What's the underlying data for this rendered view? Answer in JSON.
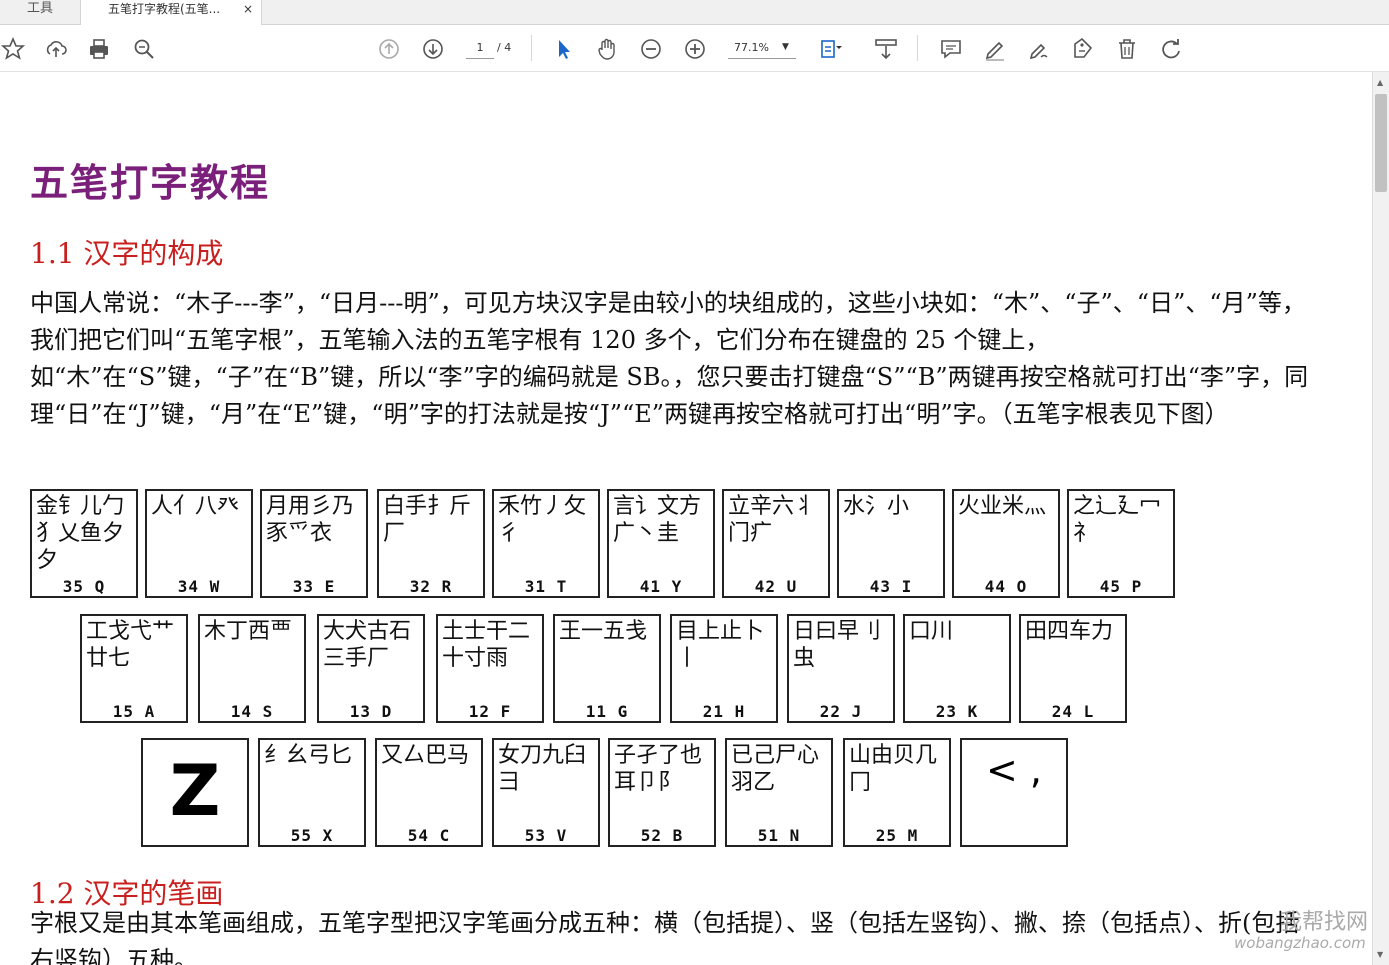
{
  "tabs": [
    {
      "label": "工具"
    },
    {
      "label": "五笔打字教程(五笔...",
      "close": "×"
    }
  ],
  "toolbar": {
    "page_current": "1",
    "page_total": "/ 4",
    "zoom": "77.1%",
    "zoom_caret": "▼",
    "icons": [
      "bookmark-star-icon",
      "upload-cloud-icon",
      "print-icon",
      "zoom-search-icon",
      "page-up-icon",
      "page-down-icon",
      "select-arrow-icon",
      "hand-pan-icon",
      "zoom-out-icon",
      "zoom-in-icon",
      "fit-page-icon",
      "scroll-mode-icon",
      "comment-icon",
      "highlight-pen-icon",
      "sign-icon",
      "stamp-icon",
      "delete-icon",
      "undo-icon"
    ]
  },
  "document": {
    "title": "五笔打字教程",
    "section1": "1.1 汉字的构成",
    "para1": "中国人常说：“木子---李”，“日月---明”，可见方块汉字是由较小的块组成的，这些小块如：“木”、“子”、“日”、“月”等，我们把它们叫“五笔字根”，五笔输入法的五笔字根有 120 多个，它们分布在键盘的 25 个键上，如“木”在“S”键，“子”在“B”键，所以“李”字的编码就是 SB。，您只要击打键盘“S”“B”两键再按空格就可打出“李”字，同理“日”在“J”键，“月”在“E”键，“明”字的打法就是按“J”“E”两键再按空格就可打出“明”字。（五笔字根表见下图）",
    "section2": "1.2 汉字的笔画",
    "para2": "字根又是由其本笔画组成，五笔字型把汉字笔画分成五种：横（包括提）、竖（包括左竖钩）、撇、捺（包括点）、折(包括右竖钩）五种。"
  },
  "keyboard": {
    "row1": [
      {
        "roots": "金钅儿勹犭乂鱼夕夕",
        "code": "35 Q"
      },
      {
        "roots": "人亻八癶",
        "code": "34 W"
      },
      {
        "roots": "月用彡乃豕爫衣",
        "code": "33 E"
      },
      {
        "roots": "白手扌斤厂",
        "code": "32 R"
      },
      {
        "roots": "禾竹丿攵彳",
        "code": "31 T"
      },
      {
        "roots": "言讠文方广丶圭",
        "code": "41 Y"
      },
      {
        "roots": "立辛六丬门疒",
        "code": "42 U"
      },
      {
        "roots": "水氵小",
        "code": "43 I"
      },
      {
        "roots": "火业米灬",
        "code": "44 O"
      },
      {
        "roots": "之辶廴冖礻",
        "code": "45 P"
      }
    ],
    "row2": [
      {
        "roots": "工戈弋艹廿七",
        "code": "15 A"
      },
      {
        "roots": "木丁西覀",
        "code": "14 S"
      },
      {
        "roots": "大犬古石三手厂",
        "code": "13 D"
      },
      {
        "roots": "土士干二十寸雨",
        "code": "12 F"
      },
      {
        "roots": "王一五戋",
        "code": "11 G"
      },
      {
        "roots": "目上止卜丨",
        "code": "21 H"
      },
      {
        "roots": "日曰早刂虫",
        "code": "22 J"
      },
      {
        "roots": "口川",
        "code": "23 K"
      },
      {
        "roots": "田四车力",
        "code": "24 L"
      }
    ],
    "row3": [
      {
        "roots": "Z",
        "code": ""
      },
      {
        "roots": "纟幺弓匕",
        "code": "55 X"
      },
      {
        "roots": "又厶巴马",
        "code": "54 C"
      },
      {
        "roots": "女刀九臼彐",
        "code": "53 V"
      },
      {
        "roots": "子孑了也耳卩阝",
        "code": "52 B"
      },
      {
        "roots": "已己尸心羽乙",
        "code": "51 N"
      },
      {
        "roots": "山由贝几冂",
        "code": "25 M"
      },
      {
        "roots": "< ,",
        "code": ""
      }
    ]
  },
  "watermark": {
    "line1": "我帮找网",
    "line2": "wobangzhao.com"
  }
}
